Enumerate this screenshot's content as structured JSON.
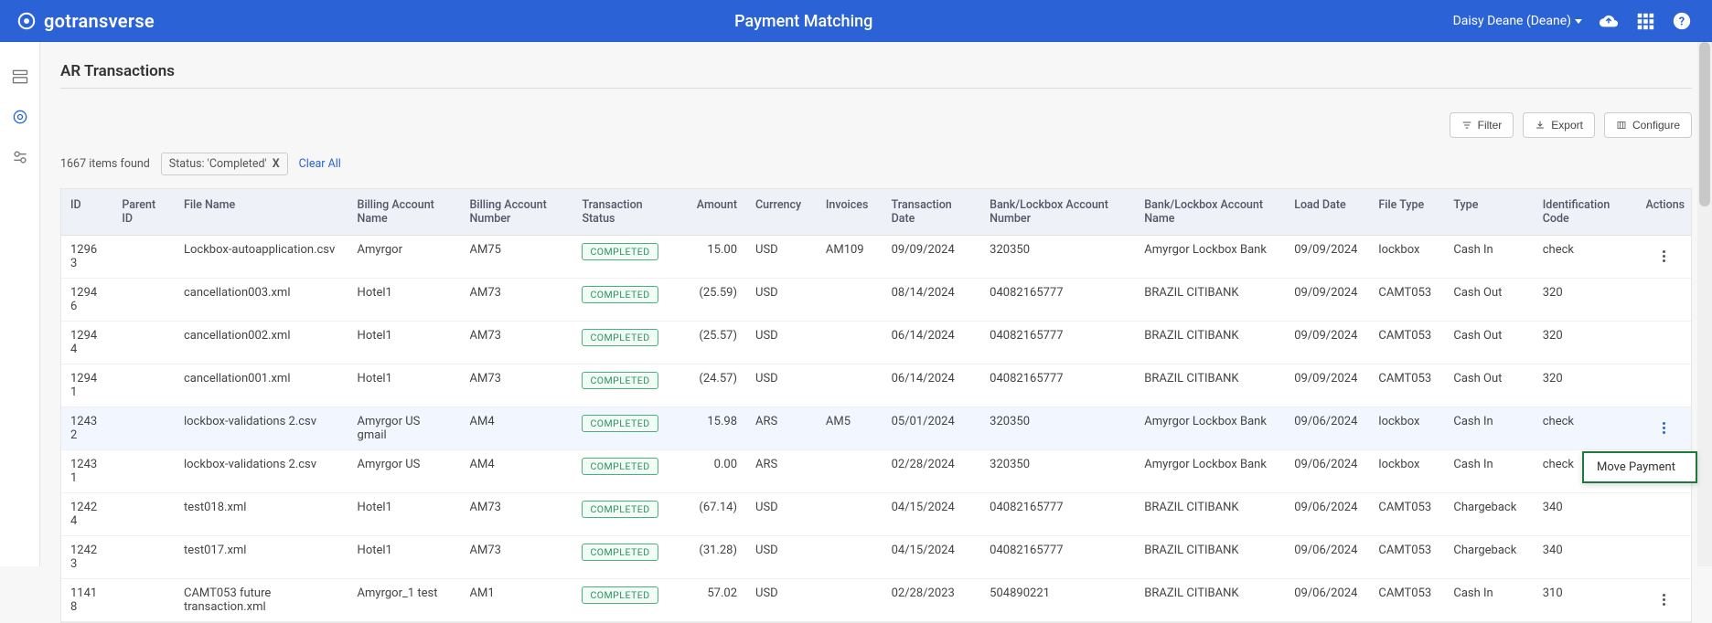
{
  "header": {
    "brand": "gotransverse",
    "title": "Payment Matching",
    "user_display": "Daisy Deane (Deane)"
  },
  "page": {
    "title": "AR Transactions",
    "count_text": "1667 items found",
    "filter_chip": "Status: 'Completed'",
    "clear_all": "Clear All"
  },
  "toolbar": {
    "filter": "Filter",
    "export": "Export",
    "configure": "Configure"
  },
  "columns": {
    "id": "ID",
    "parent_id": "Parent ID",
    "file": "File Name",
    "ba_name": "Billing Account Name",
    "ba_num": "Billing Account Number",
    "status": "Transaction Status",
    "amount": "Amount",
    "currency": "Currency",
    "invoices": "Invoices",
    "tdate": "Transaction Date",
    "bl_num": "Bank/Lockbox Account Number",
    "bl_name": "Bank/Lockbox Account Name",
    "ldate": "Load Date",
    "ftype": "File Type",
    "type": "Type",
    "idcode": "Identification Code",
    "actions": "Actions"
  },
  "rows": [
    {
      "id": "12963",
      "parent": "",
      "file": "Lockbox-autoapplication.csv",
      "ba_name": "Amyrgor",
      "ba_num": "AM75",
      "status": "COMPLETED",
      "amount": "15.00",
      "currency": "USD",
      "invoices": "AM109",
      "tdate": "09/09/2024",
      "bl_num": "320350",
      "bl_name": "Amyrgor Lockbox Bank",
      "ldate": "09/09/2024",
      "ftype": "lockbox",
      "type": "Cash In",
      "idcode": "check",
      "menu": "grey"
    },
    {
      "id": "12946",
      "parent": "",
      "file": "cancellation003.xml",
      "ba_name": "Hotel1",
      "ba_num": "AM73",
      "status": "COMPLETED",
      "amount": "(25.59)",
      "currency": "USD",
      "invoices": "",
      "tdate": "08/14/2024",
      "bl_num": "04082165777",
      "bl_name": "BRAZIL CITIBANK",
      "ldate": "09/09/2024",
      "ftype": "CAMT053",
      "type": "Cash Out",
      "idcode": "320",
      "menu": ""
    },
    {
      "id": "12944",
      "parent": "",
      "file": "cancellation002.xml",
      "ba_name": "Hotel1",
      "ba_num": "AM73",
      "status": "COMPLETED",
      "amount": "(25.57)",
      "currency": "USD",
      "invoices": "",
      "tdate": "06/14/2024",
      "bl_num": "04082165777",
      "bl_name": "BRAZIL CITIBANK",
      "ldate": "09/09/2024",
      "ftype": "CAMT053",
      "type": "Cash Out",
      "idcode": "320",
      "menu": ""
    },
    {
      "id": "12941",
      "parent": "",
      "file": "cancellation001.xml",
      "ba_name": "Hotel1",
      "ba_num": "AM73",
      "status": "COMPLETED",
      "amount": "(24.57)",
      "currency": "USD",
      "invoices": "",
      "tdate": "06/14/2024",
      "bl_num": "04082165777",
      "bl_name": "BRAZIL CITIBANK",
      "ldate": "09/09/2024",
      "ftype": "CAMT053",
      "type": "Cash Out",
      "idcode": "320",
      "menu": ""
    },
    {
      "id": "12432",
      "parent": "",
      "file": "lockbox-validations 2.csv",
      "ba_name": "Amyrgor US gmail",
      "ba_num": "AM4",
      "status": "COMPLETED",
      "amount": "15.98",
      "currency": "ARS",
      "invoices": "AM5",
      "tdate": "05/01/2024",
      "bl_num": "320350",
      "bl_name": "Amyrgor Lockbox Bank",
      "ldate": "09/06/2024",
      "ftype": "lockbox",
      "type": "Cash In",
      "idcode": "check",
      "menu": "blue",
      "highlight": true
    },
    {
      "id": "12431",
      "parent": "",
      "file": "lockbox-validations 2.csv",
      "ba_name": "Amyrgor US",
      "ba_num": "AM4",
      "status": "COMPLETED",
      "amount": "0.00",
      "currency": "ARS",
      "invoices": "",
      "tdate": "02/28/2024",
      "bl_num": "320350",
      "bl_name": "Amyrgor Lockbox Bank",
      "ldate": "09/06/2024",
      "ftype": "lockbox",
      "type": "Cash In",
      "idcode": "check",
      "menu": ""
    },
    {
      "id": "12424",
      "parent": "",
      "file": "test018.xml",
      "ba_name": "Hotel1",
      "ba_num": "AM73",
      "status": "COMPLETED",
      "amount": "(67.14)",
      "currency": "USD",
      "invoices": "",
      "tdate": "04/15/2024",
      "bl_num": "04082165777",
      "bl_name": "BRAZIL CITIBANK",
      "ldate": "09/06/2024",
      "ftype": "CAMT053",
      "type": "Chargeback",
      "idcode": "340",
      "menu": ""
    },
    {
      "id": "12423",
      "parent": "",
      "file": "test017.xml",
      "ba_name": "Hotel1",
      "ba_num": "AM73",
      "status": "COMPLETED",
      "amount": "(31.28)",
      "currency": "USD",
      "invoices": "",
      "tdate": "04/15/2024",
      "bl_num": "04082165777",
      "bl_name": "BRAZIL CITIBANK",
      "ldate": "09/06/2024",
      "ftype": "CAMT053",
      "type": "Chargeback",
      "idcode": "340",
      "menu": ""
    },
    {
      "id": "11418",
      "parent": "",
      "file": "CAMT053 future transaction.xml",
      "ba_name": "Amyrgor_1 test",
      "ba_num": "AM1",
      "status": "COMPLETED",
      "amount": "57.02",
      "currency": "USD",
      "invoices": "",
      "tdate": "02/28/2023",
      "bl_num": "504890221",
      "bl_name": "BRAZIL CITIBANK",
      "ldate": "09/06/2024",
      "ftype": "CAMT053",
      "type": "Cash In",
      "idcode": "310",
      "menu": "grey"
    }
  ],
  "context_menu": {
    "move_payment": "Move Payment"
  }
}
